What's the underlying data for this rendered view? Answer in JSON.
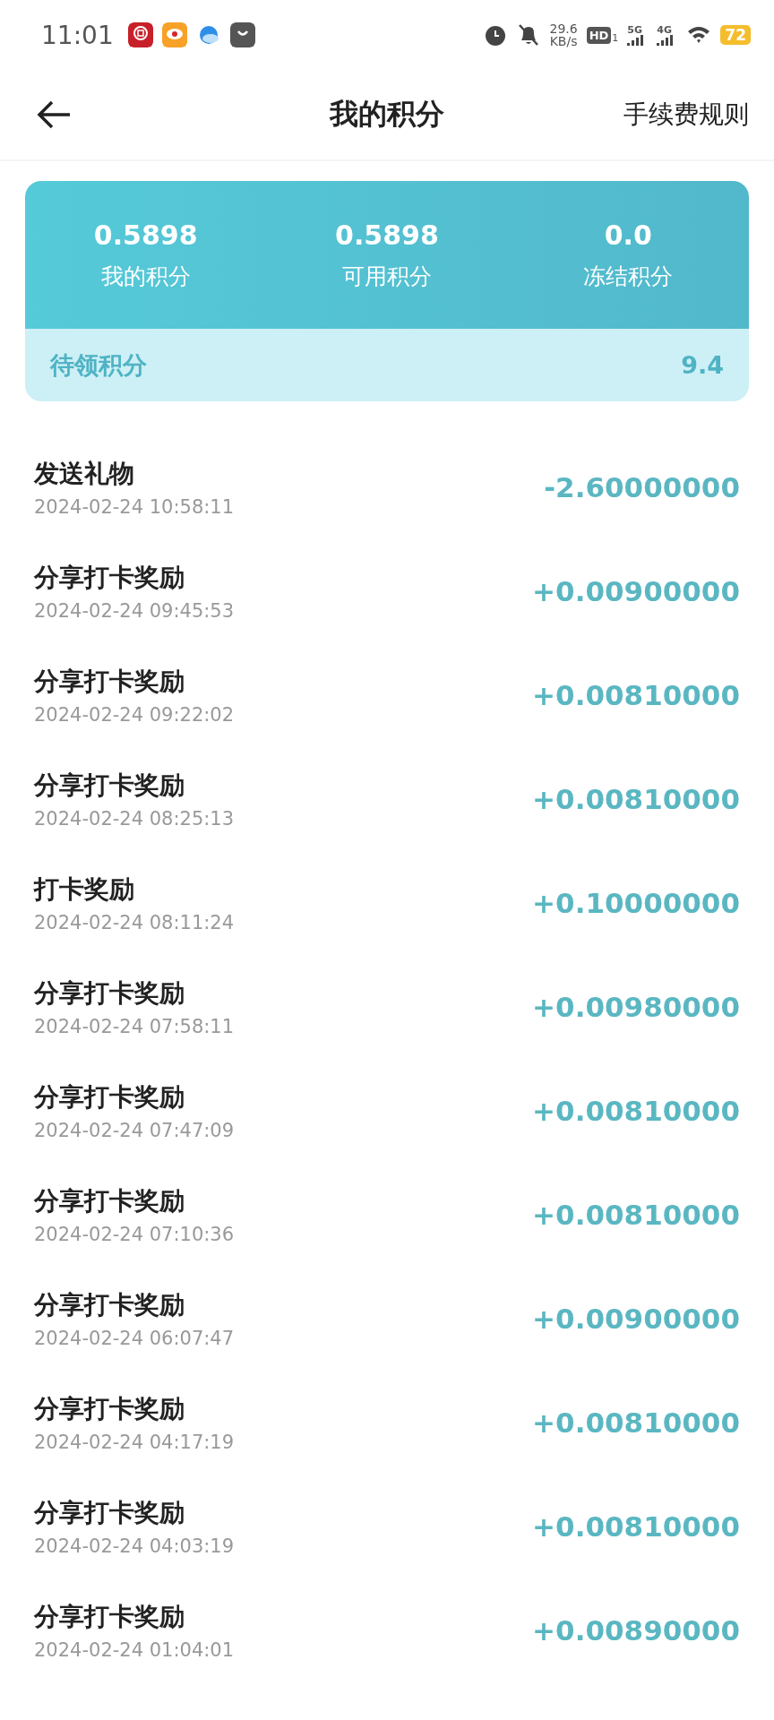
{
  "status_bar": {
    "time": "11:01",
    "net_speed": "29.6",
    "net_unit": "KB/s",
    "hd_label": "HD",
    "hd_sim": "1",
    "sim1_type": "5G",
    "sim2_type": "4G",
    "battery": "72"
  },
  "header": {
    "title": "我的积分",
    "action": "手续费规则"
  },
  "summary": {
    "stats": [
      {
        "value": "0.5898",
        "label": "我的积分"
      },
      {
        "value": "0.5898",
        "label": "可用积分"
      },
      {
        "value": "0.0",
        "label": "冻结积分"
      }
    ],
    "pending": {
      "label": "待领积分",
      "value": "9.4"
    }
  },
  "records": [
    {
      "title": "发送礼物",
      "time": "2024-02-24 10:58:11",
      "amount": "-2.60000000"
    },
    {
      "title": "分享打卡奖励",
      "time": "2024-02-24 09:45:53",
      "amount": "+0.00900000"
    },
    {
      "title": "分享打卡奖励",
      "time": "2024-02-24 09:22:02",
      "amount": "+0.00810000"
    },
    {
      "title": "分享打卡奖励",
      "time": "2024-02-24 08:25:13",
      "amount": "+0.00810000"
    },
    {
      "title": "打卡奖励",
      "time": "2024-02-24 08:11:24",
      "amount": "+0.10000000"
    },
    {
      "title": "分享打卡奖励",
      "time": "2024-02-24 07:58:11",
      "amount": "+0.00980000"
    },
    {
      "title": "分享打卡奖励",
      "time": "2024-02-24 07:47:09",
      "amount": "+0.00810000"
    },
    {
      "title": "分享打卡奖励",
      "time": "2024-02-24 07:10:36",
      "amount": "+0.00810000"
    },
    {
      "title": "分享打卡奖励",
      "time": "2024-02-24 06:07:47",
      "amount": "+0.00900000"
    },
    {
      "title": "分享打卡奖励",
      "time": "2024-02-24 04:17:19",
      "amount": "+0.00810000"
    },
    {
      "title": "分享打卡奖励",
      "time": "2024-02-24 04:03:19",
      "amount": "+0.00810000"
    },
    {
      "title": "分享打卡奖励",
      "time": "2024-02-24 01:04:01",
      "amount": "+0.00890000"
    }
  ]
}
